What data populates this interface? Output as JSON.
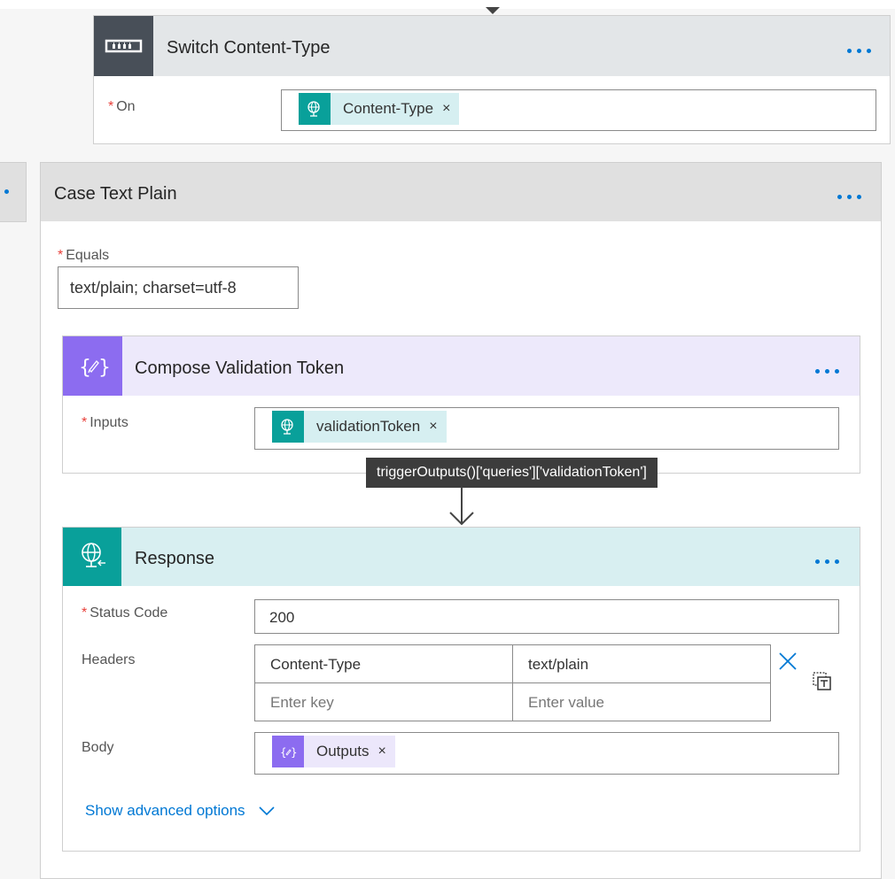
{
  "switch": {
    "title": "Switch Content-Type",
    "on_label": "On",
    "on_token": "Content-Type",
    "required_mark": "*"
  },
  "case": {
    "title": "Case Text Plain",
    "equals_label": "Equals",
    "equals_value": "text/plain; charset=utf-8"
  },
  "compose": {
    "title": "Compose Validation Token",
    "inputs_label": "Inputs",
    "inputs_token": "validationToken"
  },
  "tooltip": {
    "text": "triggerOutputs()['queries']['validationToken']"
  },
  "response": {
    "title": "Response",
    "status_code_label": "Status Code",
    "status_code_value": "200",
    "headers_label": "Headers",
    "headers": [
      {
        "key": "Content-Type",
        "value": "text/plain"
      }
    ],
    "header_key_placeholder": "Enter key",
    "header_value_placeholder": "Enter value",
    "body_label": "Body",
    "body_token": "Outputs",
    "advanced_link": "Show advanced options"
  },
  "token_remove_glyph": "×",
  "colors": {
    "switch_header": "#e3e6e8",
    "switch_icon_bg": "#484f58",
    "case_header": "#e0e0e0",
    "compose_header": "#ede9fb",
    "compose_icon_bg": "#8c6cf0",
    "response_header": "#d8eff1",
    "response_icon_bg": "#09a09a",
    "token_teal_bg": "#d6eff1",
    "token_purple_bg": "#ece7fb",
    "accent": "#0078d4"
  }
}
